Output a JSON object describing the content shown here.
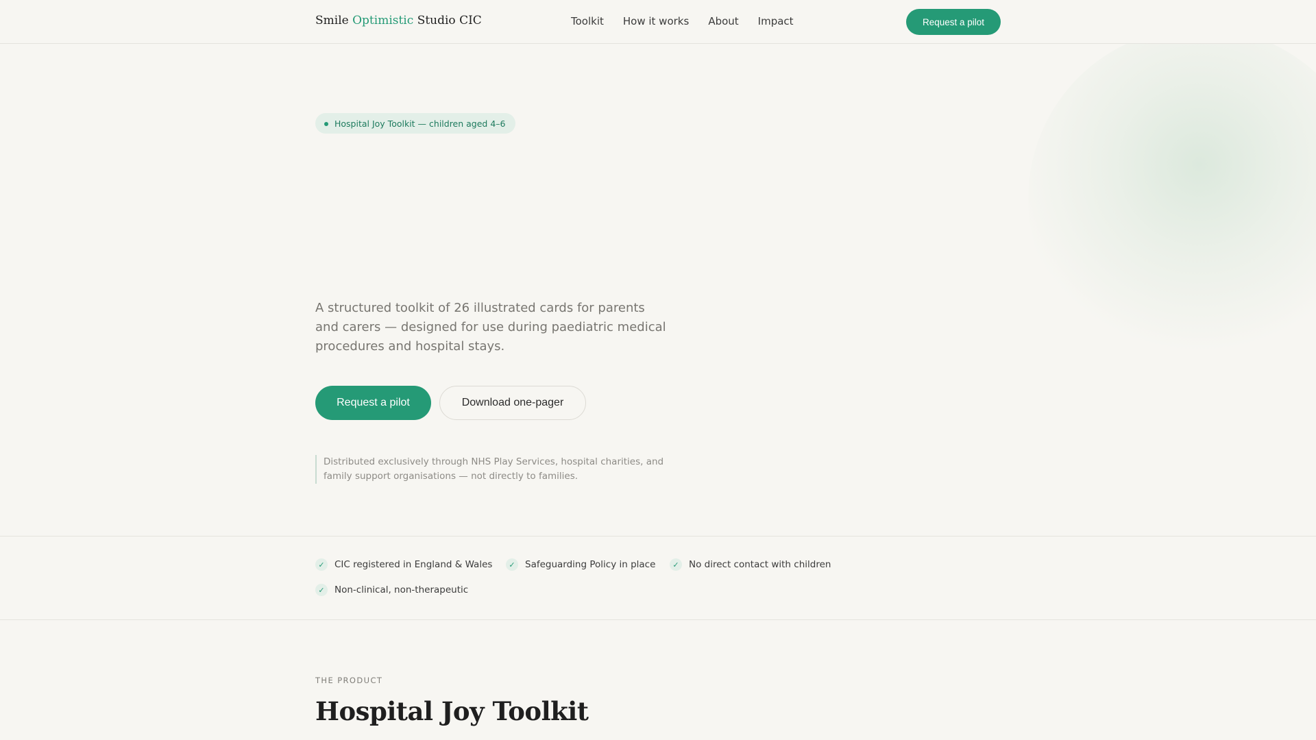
{
  "header": {
    "brand_part1": "Smile",
    "brand_accent": "Optimistic",
    "brand_part2": "Studio CIC",
    "nav": [
      "Toolkit",
      "How it works",
      "About",
      "Impact"
    ],
    "cta_label": "Request a pilot"
  },
  "hero": {
    "pill": "Hospital Joy Toolkit — children aged 4–6",
    "description": "A structured toolkit of 26 illustrated cards for parents and carers — designed for use during paediatric medical procedures and hospital stays.",
    "primary_cta": "Request a pilot",
    "secondary_cta": "Download one-pager",
    "note": "Distributed exclusively through NHS Play Services, hospital charities, and family support organisations — not directly to families."
  },
  "trust": {
    "items": [
      "CIC registered in England & Wales",
      "Safeguarding Policy in place",
      "No direct contact with children",
      "Non-clinical, non-therapeutic"
    ],
    "icon": "check-icon"
  },
  "product": {
    "eyebrow": "THE PRODUCT",
    "title": "Hospital Joy Toolkit"
  },
  "colors": {
    "background": "#f7f6f2",
    "accent": "#259a76",
    "pill_bg": "#e3efe8",
    "text": "#2b2b2b",
    "muted": "#777570"
  }
}
